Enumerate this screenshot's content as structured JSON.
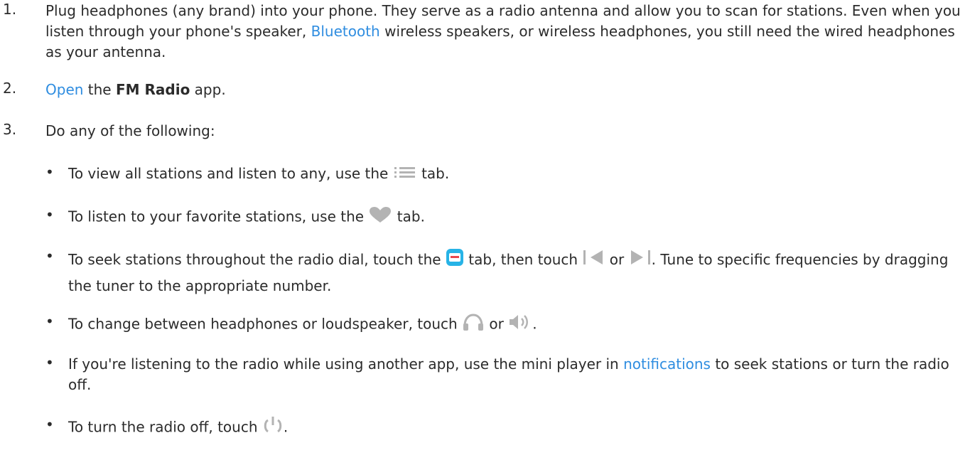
{
  "steps": [
    {
      "number": "1.",
      "text_before_link": "Plug headphones (any brand) into your phone. They serve as a radio antenna and allow you to scan for stations. Even when you listen through your phone's speaker, ",
      "link": "Bluetooth",
      "text_after_link": " wireless speakers, or wireless headphones, you still need the wired headphones as your antenna."
    },
    {
      "number": "2.",
      "link": "Open",
      "text_mid": " the ",
      "bold": "FM Radio",
      "text_end": " app."
    },
    {
      "number": "3.",
      "text": "Do any of the following:"
    }
  ],
  "bullets": [
    {
      "bullet": "•",
      "before": "To view all stations and listen to any, use the ",
      "after": " tab.",
      "icon": "list-icon"
    },
    {
      "bullet": "•",
      "before": "To listen to your favorite stations, use the ",
      "after": " tab.",
      "icon": "heart-icon"
    },
    {
      "bullet": "•",
      "before": "To seek stations throughout the radio dial, touch the ",
      "mid1": " tab, then touch ",
      "mid2": " or ",
      "after": ". Tune to specific frequencies by dragging the tuner to the appropriate number.",
      "icons": [
        "radio-tab-icon",
        "seek-back-icon",
        "seek-forward-icon"
      ]
    },
    {
      "bullet": "•",
      "before": "To change between headphones or loudspeaker, touch ",
      "mid": " or ",
      "after": ".",
      "icons": [
        "headphones-icon",
        "speaker-icon"
      ]
    },
    {
      "bullet": "•",
      "before": "If you're listening to the radio while using another app, use the mini player in ",
      "link": "notifications",
      "after": " to seek stations or turn the radio off."
    },
    {
      "bullet": "•",
      "before": "To turn the radio off, touch ",
      "after": ".",
      "icon": "power-icon"
    }
  ],
  "colors": {
    "link": "#2f8de0",
    "icon_gray": "#b3b3b3",
    "radio_icon": "#27b3e6",
    "radio_red": "#e8474c",
    "text": "#2b2b2b"
  }
}
